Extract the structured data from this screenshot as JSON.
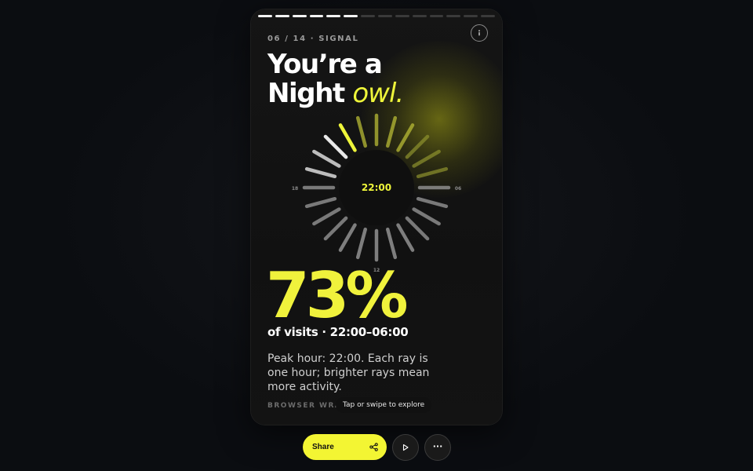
{
  "story": {
    "kicker": "06 / 14 · SIGNAL",
    "title_line1": "You’re a",
    "title_line2": "Night",
    "title_accent": "owl.",
    "stat": "73%",
    "range": "of visits · 22:00–06:00",
    "description": "Peak hour: 22:00. Each ray is one hour; brighter rays mean more activity.",
    "brand": "BROWSER WRAPPED",
    "hint": "Tap or swipe to explore",
    "progress": {
      "total": 14,
      "current": 6
    }
  },
  "dial": {
    "center_label": "22:00",
    "tick_labels": {
      "left": "18",
      "right": "06",
      "bottom": "12"
    },
    "peak_hour": 22,
    "highlight_color": "#eef53a",
    "base_color": "#8c8c8c"
  },
  "actions": {
    "share_label": "Share",
    "play_icon": "play-icon",
    "more_label": "···"
  },
  "icons": {
    "info": "info-icon",
    "share": "share-icon"
  }
}
